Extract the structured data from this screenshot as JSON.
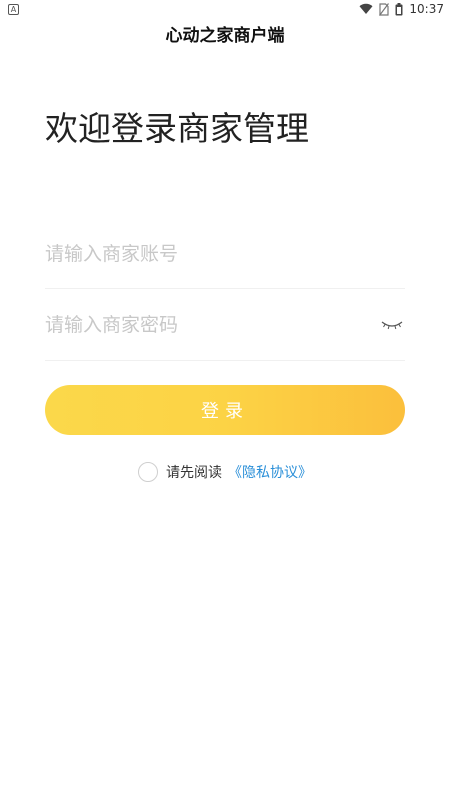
{
  "status_bar": {
    "notification_badge": "A",
    "time": "10:37",
    "icons": [
      "wifi-icon",
      "no-sim-icon",
      "battery-icon"
    ]
  },
  "header": {
    "title": "心动之家商户端"
  },
  "main": {
    "welcome": "欢迎登录商家管理",
    "account_placeholder": "请输入商家账号",
    "password_placeholder": "请输入商家密码",
    "password_toggle_icon": "eye-closed-icon",
    "login_label": "登录",
    "agreement_prefix": "请先阅读",
    "privacy_link": "《隐私协议》"
  },
  "colors": {
    "button_gradient_start": "#fbd84a",
    "button_gradient_end": "#fbbf3c",
    "link": "#2a8fd8",
    "placeholder": "#c8c8c8"
  }
}
